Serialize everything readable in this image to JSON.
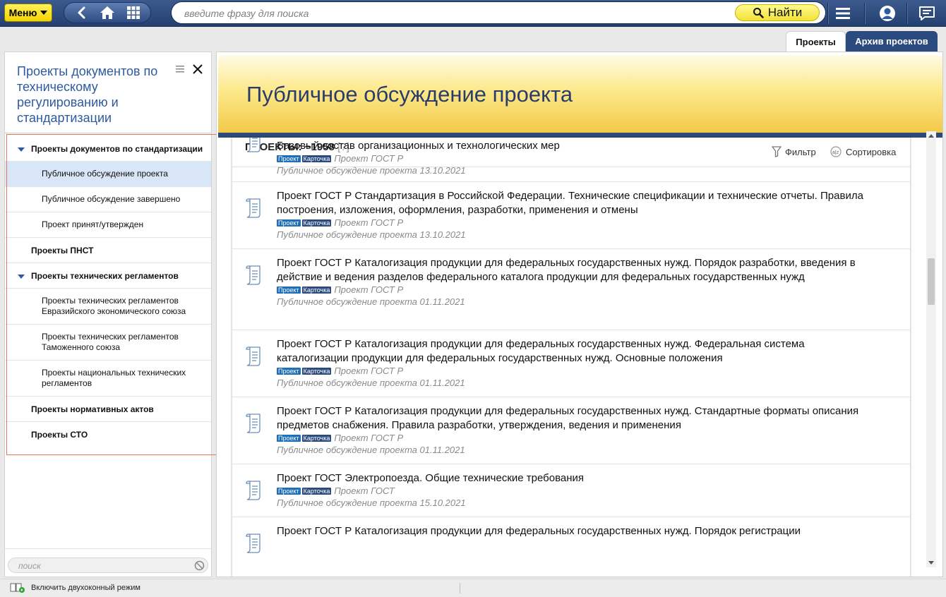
{
  "toolbar": {
    "menu_label": "Меню",
    "search_placeholder": "введите фразу для поиска",
    "find_label": "Найти"
  },
  "tabs": [
    {
      "label": "Проекты"
    },
    {
      "label": "Архив проектов"
    }
  ],
  "sidebar": {
    "title": "Проекты документов по техническому регулированию и стандартизации",
    "items": [
      {
        "label": "Проекты документов по стандартизации"
      },
      {
        "label": "Публичное обсуждение проекта"
      },
      {
        "label": "Публичное обсуждение завершено"
      },
      {
        "label": "Проект принят/утвержден"
      },
      {
        "label": "Проекты ПНСТ"
      },
      {
        "label": "Проекты технических регламентов"
      },
      {
        "label": "Проекты технических регламентов Евразийского экономического союза"
      },
      {
        "label": "Проекты технических регламентов Таможенного союза"
      },
      {
        "label": "Проекты национальных технических регламентов"
      },
      {
        "label": "Проекты нормативных актов"
      },
      {
        "label": "Проекты СТО"
      }
    ],
    "search_placeholder": "поиск"
  },
  "main": {
    "title": "Публичное обсуждение проекта",
    "count_label": "ПРОЕКТЫ: ~1958",
    "count_hint": "[?]",
    "filter_label": "Фильтр",
    "sort_label": "Сортировка",
    "badge_project": "Проект",
    "badge_card": "Карточка",
    "rows": [
      {
        "title": "Базовый состав организационных и технологических мер",
        "type": "Проект ГОСТ Р",
        "status": "Публичное обсуждение проекта 13.10.2021"
      },
      {
        "title": "Проект ГОСТ Р Стандартизация в Российской Федерации. Технические спецификации и технические отчеты. Правила построения, изложения, оформления, разработки, применения и отмены",
        "type": "Проект ГОСТ Р",
        "status": "Публичное обсуждение проекта 13.10.2021"
      },
      {
        "title": "Проект ГОСТ Р Каталогизация продукции для федеральных государственных нужд. Порядок разработки, введения в действие и ведения разделов федерального каталога продукции для федеральных государственных нужд",
        "type": "Проект ГОСТ Р",
        "status": "Публичное обсуждение проекта 01.11.2021"
      },
      {
        "title": "Проект ГОСТ Р Каталогизация продукции для федеральных государственных нужд. Федеральная система каталогизации продукции для федеральных государственных нужд. Основные положения",
        "type": "Проект ГОСТ Р",
        "status": "Публичное обсуждение проекта 01.11.2021"
      },
      {
        "title": "Проект ГОСТ Р Каталогизация продукции для федеральных государственных нужд. Стандартные форматы описания предметов снабжения. Правила разработки, утверждения, ведения и применения",
        "type": "Проект ГОСТ Р",
        "status": "Публичное обсуждение проекта 01.11.2021"
      },
      {
        "title": "Проект ГОСТ Электропоезда. Общие технические требования",
        "type": "Проект ГОСТ",
        "status": "Публичное обсуждение проекта 15.10.2021"
      },
      {
        "title": "Проект ГОСТ Р Каталогизация продукции для федеральных государственных нужд. Порядок регистрации",
        "type": "",
        "status": ""
      }
    ]
  },
  "statusbar": {
    "two_window_label": "Включить двухоконный режим"
  },
  "colors": {
    "brand_blue": "#2b4a7d",
    "accent_yellow": "#f3d400",
    "link_blue": "#2d5aa0",
    "selection": "#d8e6f7",
    "highlight_border": "#e07a5a"
  }
}
